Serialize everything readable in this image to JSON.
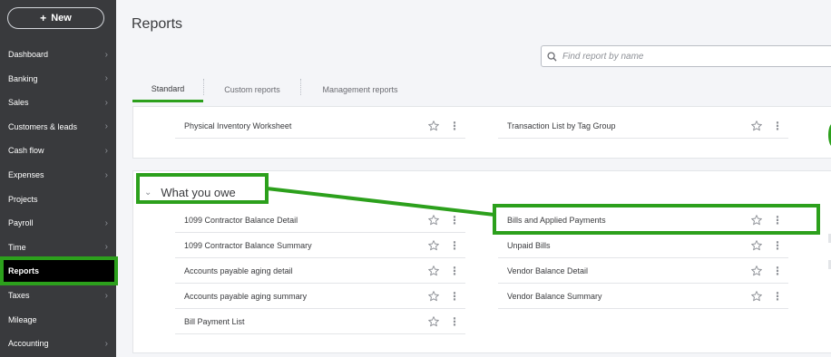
{
  "sidebar": {
    "new_label": "New",
    "items": [
      {
        "label": "Dashboard",
        "chevron": true
      },
      {
        "label": "Banking",
        "chevron": true
      },
      {
        "label": "Sales",
        "chevron": true
      },
      {
        "label": "Customers & leads",
        "chevron": true
      },
      {
        "label": "Cash flow",
        "chevron": true
      },
      {
        "label": "Expenses",
        "chevron": true
      },
      {
        "label": "Projects",
        "chevron": false
      },
      {
        "label": "Payroll",
        "chevron": true
      },
      {
        "label": "Time",
        "chevron": true
      },
      {
        "label": "Reports",
        "chevron": false,
        "active": true
      },
      {
        "label": "Taxes",
        "chevron": true
      },
      {
        "label": "Mileage",
        "chevron": false
      },
      {
        "label": "Accounting",
        "chevron": true
      }
    ]
  },
  "page": {
    "title": "Reports",
    "search_placeholder": "Find report by name"
  },
  "tabs": [
    {
      "label": "Standard",
      "active": true
    },
    {
      "label": "Custom reports",
      "active": false
    },
    {
      "label": "Management reports",
      "active": false
    }
  ],
  "top_section": {
    "left": [
      "Physical Inventory Worksheet"
    ],
    "right": [
      "Transaction List by Tag Group"
    ]
  },
  "owe_section": {
    "title": "What you owe",
    "left": [
      "1099 Contractor Balance Detail",
      "1099 Contractor Balance Summary",
      "Accounts payable aging detail",
      "Accounts payable aging summary",
      "Bill Payment List"
    ],
    "right": [
      "Bills and Applied Payments",
      "Unpaid Bills",
      "Vendor Balance Detail",
      "Vendor Balance Summary"
    ]
  },
  "colors": {
    "sidebar_bg": "#393a3d",
    "active_bg": "#000000",
    "highlight": "#2ca01c",
    "page_bg": "#f4f5f8"
  }
}
